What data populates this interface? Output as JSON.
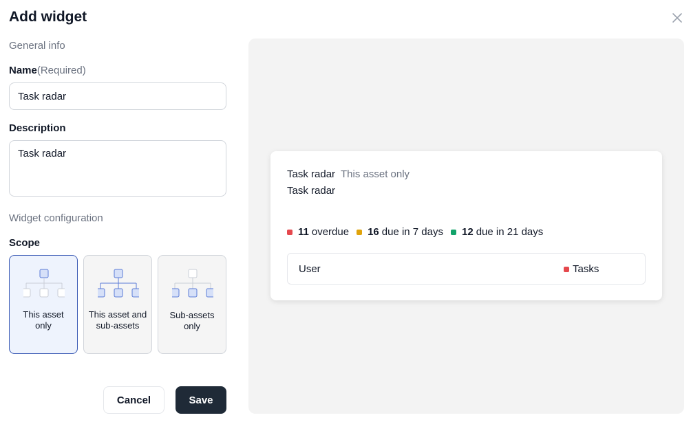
{
  "dialog": {
    "title": "Add widget"
  },
  "form": {
    "general_info_label": "General info",
    "name": {
      "label": "Name",
      "required_hint": "(Required)",
      "value": "Task radar"
    },
    "description": {
      "label": "Description",
      "value": "Task radar"
    },
    "widget_configuration_label": "Widget configuration",
    "scope": {
      "label": "Scope",
      "options": [
        {
          "label": "This asset only",
          "selected": true
        },
        {
          "label": "This asset and sub-assets",
          "selected": false
        },
        {
          "label": "Sub-assets only",
          "selected": false
        }
      ]
    }
  },
  "buttons": {
    "cancel": "Cancel",
    "save": "Save"
  },
  "preview": {
    "title": "Task radar",
    "scope": "This asset only",
    "description": "Task radar",
    "stats": [
      {
        "count": "11",
        "label": "overdue",
        "color": "#e5484d"
      },
      {
        "count": "16",
        "label": "due in 7 days",
        "color": "#e0a30b"
      },
      {
        "count": "12",
        "label": "due in 21 days",
        "color": "#12a36a"
      }
    ],
    "table": {
      "columns": [
        "User",
        "Tasks"
      ],
      "tasks_color": "#e5484d"
    }
  },
  "colors": {
    "primary_button": "#1f2a37",
    "selected_card_border": "#3b5bb5",
    "selected_card_bg": "#eef3fd"
  }
}
